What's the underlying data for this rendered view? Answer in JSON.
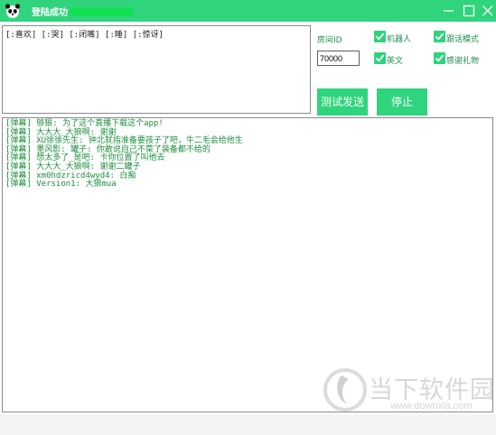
{
  "window": {
    "title": "登陆成功",
    "controls": {
      "minimize": "minimize-icon",
      "maximize": "maximize-icon",
      "close": "close-icon"
    }
  },
  "input": {
    "text": "[:喜欢] [:哭] [:闭嘴] [:睡] [:惊讶]"
  },
  "settings": {
    "room_id_label": "房间ID",
    "room_id_value": "70000",
    "robot_label": "机器人",
    "robot_checked": true,
    "follow_mode_label": "跟话模式",
    "follow_mode_checked": true,
    "english_label": "英文",
    "english_checked": true,
    "thanks_gift_label": "感谢礼物",
    "thanks_gift_checked": true
  },
  "buttons": {
    "test_send": "测试发送",
    "stop": "停止"
  },
  "log": [
    "[弹幕] 够狠: 为了这个直播下载这个app!",
    "[弹幕] 大大大_大狼啊: 谢谢",
    "[弹幕] XU徐徐先生: 钟北就指准备要孩子了吧，牛二毛会给他生",
    "[弹幕] 墨风影: 罐子: 你敢说自己不菜了装备都不给的",
    "[弹幕] 想太多了_是吧: 卡你位置了叫他去",
    "[弹幕] 大大大_大狼啊: 谢谢二罐子",
    "[弹幕] xm0hdzricd4wyd4: 白痴",
    "[弹幕] Version1: 大狼mua"
  ],
  "watermark": {
    "site_name": "当下软件园",
    "url": "www.downxia.com"
  },
  "colors": {
    "accent": "#2fd47c",
    "label_text": "#1f8f4d",
    "log_text": "#1b8e3c",
    "username_highlight": "#11e055"
  }
}
